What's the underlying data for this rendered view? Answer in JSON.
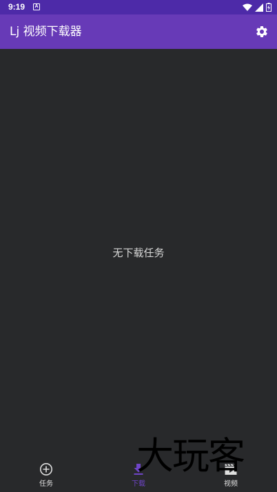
{
  "status_bar": {
    "time": "9:19",
    "notification_letter": "A",
    "background": "#4d2aa8"
  },
  "app_bar": {
    "title": "Lj 视频下载器",
    "settings_icon": "gear-icon",
    "background": "#673ab7"
  },
  "main": {
    "empty_message": "无下载任务"
  },
  "bottom_nav": {
    "items": [
      {
        "label": "任务",
        "icon": "plus-circle-icon",
        "active": false
      },
      {
        "label": "下载",
        "icon": "download-icon",
        "active": true
      },
      {
        "label": "视频",
        "icon": "movie-clapper-icon",
        "active": false
      }
    ],
    "active_color": "#6f45c8"
  },
  "watermark": {
    "text": "大玩客"
  }
}
